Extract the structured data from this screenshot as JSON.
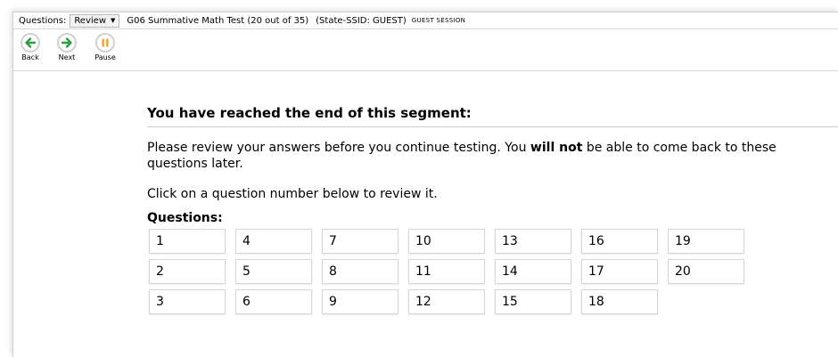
{
  "topbar": {
    "questions_label": "Questions:",
    "dropdown_value": "Review",
    "test_title": "G06 Summative Math Test (20 out of 35)",
    "ssid": "(State-SSID: GUEST)",
    "session": "GUEST SESSION"
  },
  "toolbar": {
    "back_label": "Back",
    "next_label": "Next",
    "pause_label": "Pause",
    "colors": {
      "back": "#2e9e3e",
      "next": "#2e9e3e",
      "pause": "#f5a623"
    }
  },
  "main": {
    "title": "You have reached the end of this segment:",
    "para1_pre": "Please review your answers before you continue testing. You ",
    "para1_bold": "will not",
    "para1_post": " be able to come back to these questions later.",
    "para2": "Click on a question number below to review it.",
    "questions_heading": "Questions:",
    "questions": [
      "1",
      "2",
      "3",
      "4",
      "5",
      "6",
      "7",
      "8",
      "9",
      "10",
      "11",
      "12",
      "13",
      "14",
      "15",
      "16",
      "17",
      "18",
      "19",
      "20"
    ]
  }
}
